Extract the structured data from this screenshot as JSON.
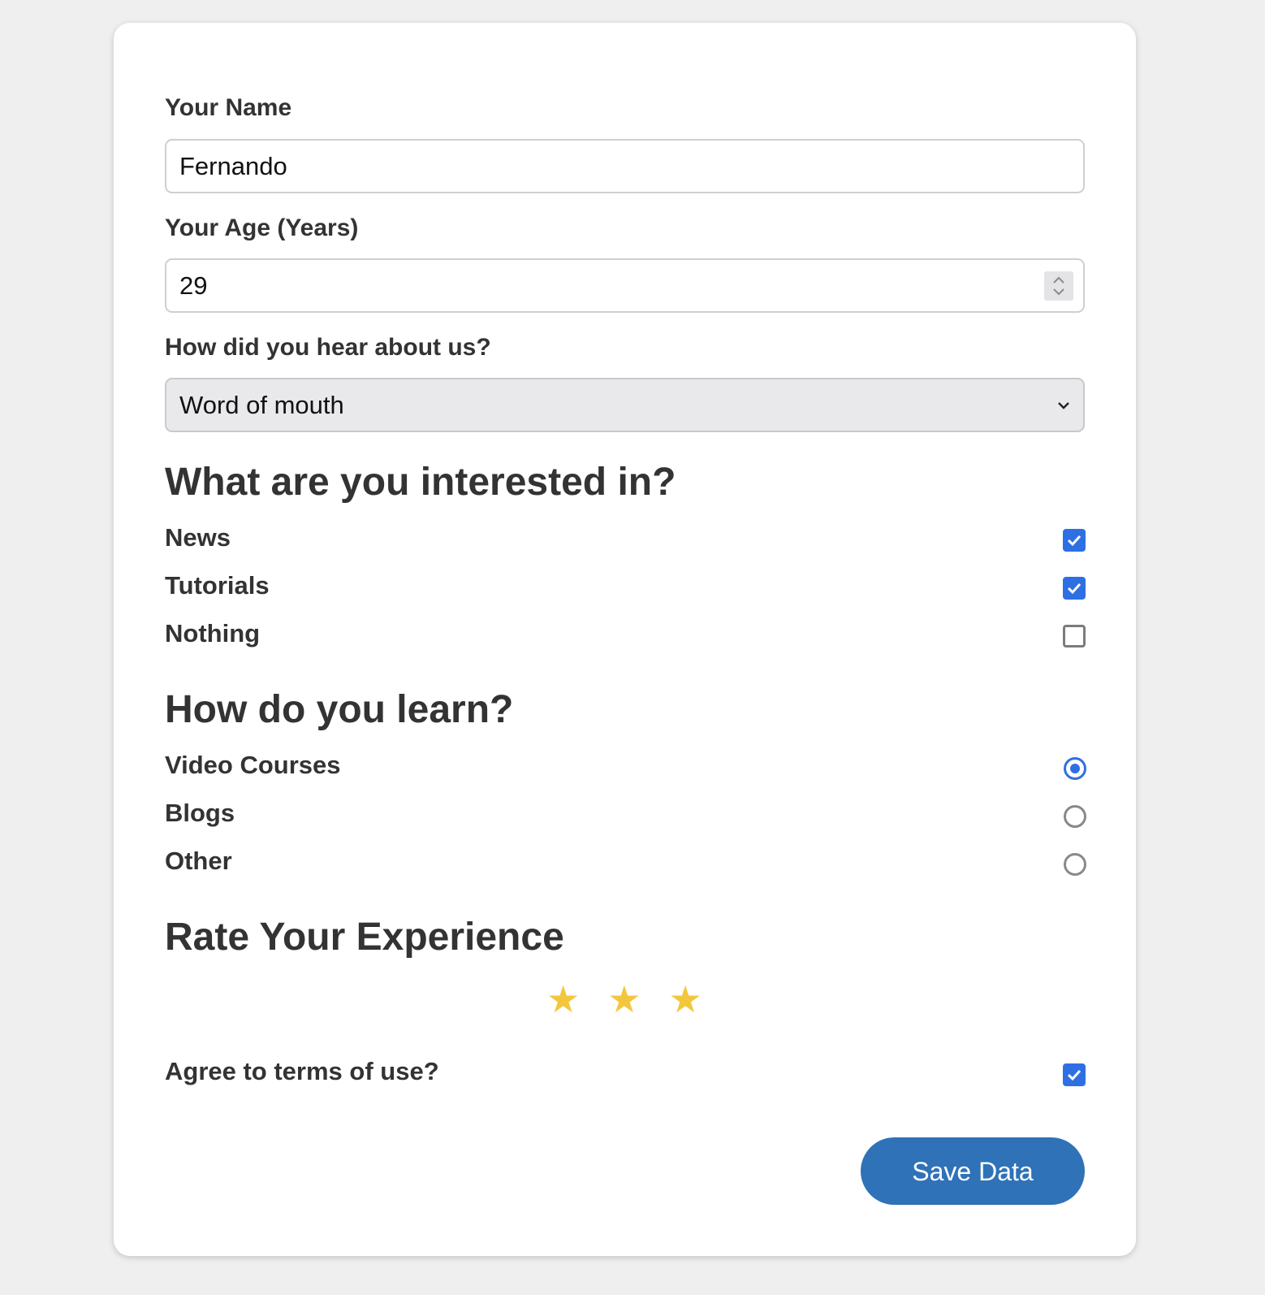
{
  "form": {
    "name": {
      "label": "Your Name",
      "value": "Fernando"
    },
    "age": {
      "label": "Your Age (Years)",
      "value": "29"
    },
    "source": {
      "label": "How did you hear about us?",
      "selected": "Word of mouth"
    }
  },
  "interests": {
    "heading": "What are you interested in?",
    "items": [
      {
        "label": "News",
        "checked": true
      },
      {
        "label": "Tutorials",
        "checked": true
      },
      {
        "label": "Nothing",
        "checked": false
      }
    ]
  },
  "learning": {
    "heading": "How do you learn?",
    "items": [
      {
        "label": "Video Courses",
        "selected": true
      },
      {
        "label": "Blogs",
        "selected": false
      },
      {
        "label": "Other",
        "selected": false
      }
    ]
  },
  "rating": {
    "heading": "Rate Your Experience",
    "value": 3,
    "star_glyph": "★",
    "star_color": "#f3c73d"
  },
  "terms": {
    "label": "Agree to terms of use?",
    "checked": true
  },
  "save_button": {
    "label": "Save Data"
  },
  "colors": {
    "accent": "#2f6fe4",
    "button": "#2f72b8",
    "text": "#333333",
    "background": "#efefef"
  }
}
